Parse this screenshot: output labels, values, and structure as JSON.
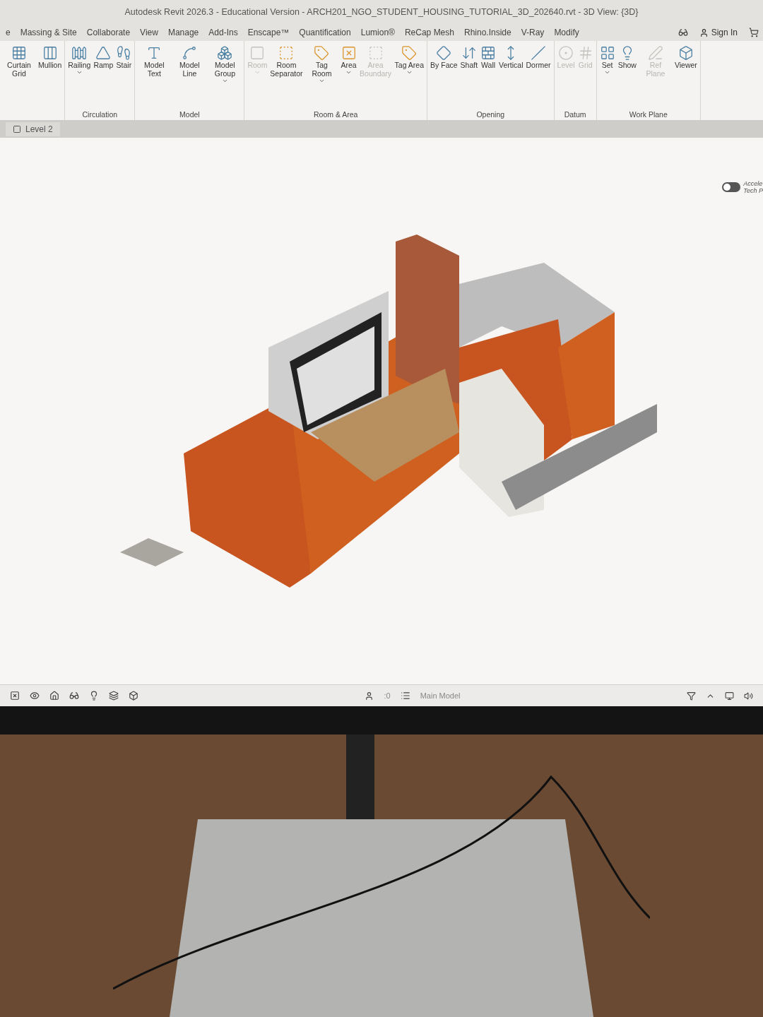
{
  "window": {
    "title": "Autodesk Revit 2026.3 - Educational Version - ARCH201_NGO_STUDENT_HOUSING_TUTORIAL_3D_202640.rvt - 3D View: {3D}"
  },
  "tabs": [
    {
      "label": "e",
      "selected": false
    },
    {
      "label": "Massing & Site",
      "selected": false
    },
    {
      "label": "Collaborate",
      "selected": false
    },
    {
      "label": "View",
      "selected": false
    },
    {
      "label": "Manage",
      "selected": false
    },
    {
      "label": "Add-Ins",
      "selected": false
    },
    {
      "label": "Enscape™",
      "selected": false
    },
    {
      "label": "Quantification",
      "selected": false
    },
    {
      "label": "Lumion®",
      "selected": false
    },
    {
      "label": "ReCap Mesh",
      "selected": false
    },
    {
      "label": "Rhino.Inside",
      "selected": false
    },
    {
      "label": "V-Ray",
      "selected": false
    },
    {
      "label": "Modify",
      "selected": false
    }
  ],
  "account": {
    "label": "Sign In"
  },
  "panels": [
    {
      "tools": [
        {
          "label": "Curtain Grid",
          "disabled": false,
          "dropdown": false
        },
        {
          "label": "Mullion",
          "disabled": false,
          "dropdown": false
        }
      ]
    },
    {
      "title": "Circulation",
      "tools": [
        {
          "label": "Railing",
          "disabled": false,
          "dropdown": true
        },
        {
          "label": "Ramp",
          "disabled": false,
          "dropdown": false
        },
        {
          "label": "Stair",
          "disabled": false,
          "dropdown": false
        }
      ]
    },
    {
      "title": "Model",
      "tools": [
        {
          "label": "Model Text",
          "disabled": false,
          "dropdown": false
        },
        {
          "label": "Model Line",
          "disabled": false,
          "dropdown": false
        },
        {
          "label": "Model Group",
          "disabled": false,
          "dropdown": true
        }
      ]
    },
    {
      "title": "Room & Area",
      "tools": [
        {
          "label": "Room",
          "disabled": true,
          "dropdown": true
        },
        {
          "label": "Room Separator",
          "disabled": false,
          "dropdown": false
        },
        {
          "label": "Tag Room",
          "disabled": false,
          "dropdown": true
        },
        {
          "label": "Area",
          "disabled": false,
          "dropdown": true
        },
        {
          "label": "Area Boundary",
          "disabled": true,
          "dropdown": false
        },
        {
          "label": "Tag Area",
          "disabled": false,
          "dropdown": true
        }
      ]
    },
    {
      "title": "Opening",
      "tools": [
        {
          "label": "By Face",
          "disabled": false,
          "dropdown": false
        },
        {
          "label": "Shaft",
          "disabled": false,
          "dropdown": false
        },
        {
          "label": "Wall",
          "disabled": false,
          "dropdown": false
        },
        {
          "label": "Vertical",
          "disabled": false,
          "dropdown": false
        },
        {
          "label": "Dormer",
          "disabled": false,
          "dropdown": false
        }
      ]
    },
    {
      "title": "Datum",
      "tools": [
        {
          "label": "Level",
          "disabled": true,
          "dropdown": false
        },
        {
          "label": "Grid",
          "disabled": true,
          "dropdown": false
        }
      ]
    },
    {
      "title": "Work Plane",
      "tools": [
        {
          "label": "Set",
          "disabled": false,
          "dropdown": true
        },
        {
          "label": "Show",
          "disabled": false,
          "dropdown": false
        },
        {
          "label": "Ref Plane",
          "disabled": true,
          "dropdown": false
        },
        {
          "label": "Viewer",
          "disabled": false,
          "dropdown": false
        }
      ]
    }
  ],
  "view_tab": {
    "label": "Level 2"
  },
  "toggle": {
    "on": false,
    "label_lines": [
      "Accele",
      "Tech P"
    ]
  },
  "status_bar": {
    "count": ":0",
    "model": "Main Model"
  }
}
